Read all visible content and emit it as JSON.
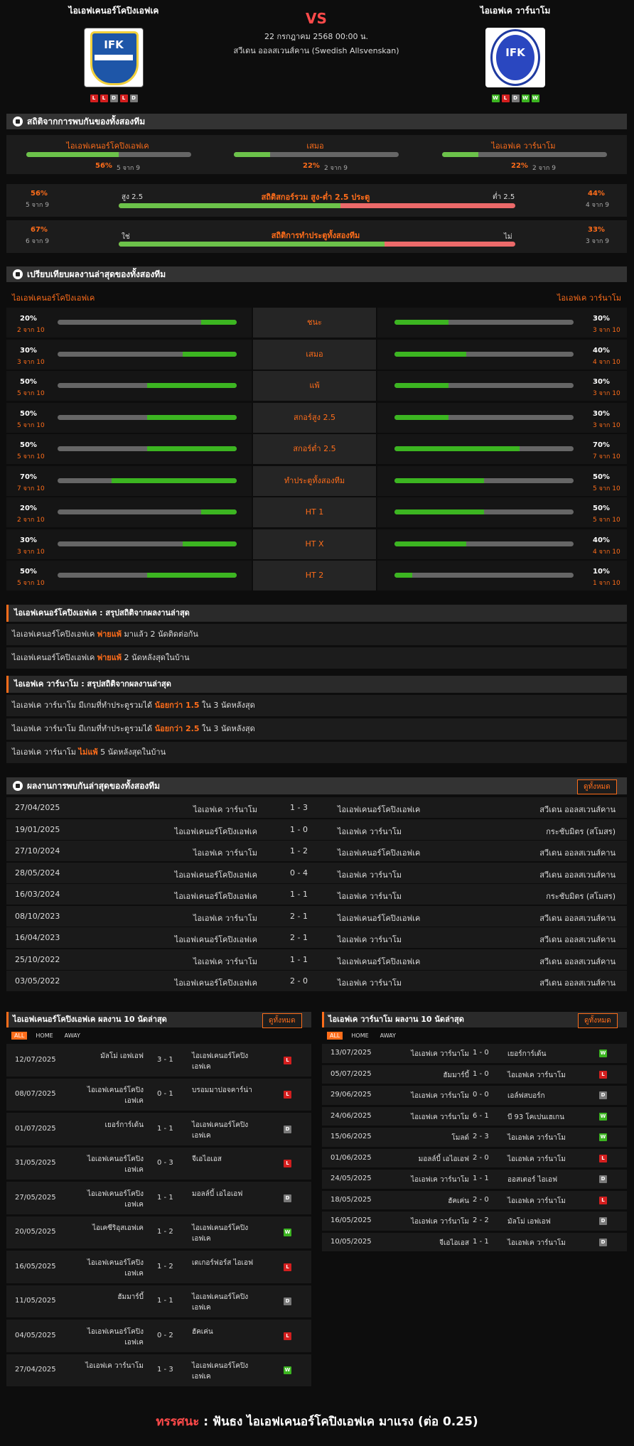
{
  "match": {
    "home": "ไอเอฟเคนอร์โคปิงเอฟเค",
    "away": "ไอเอฟเค วาร์นาโม",
    "vs": "VS",
    "date": "22 กรกฎาคม 2568 00:00 น.",
    "league": "สวีเดน ออลสเวนส์คาน (Swedish Allsvenskan)",
    "home_logo_text": "IFK",
    "away_logo_text": "IFK",
    "home_form": [
      "L",
      "L",
      "D",
      "L",
      "D"
    ],
    "away_form": [
      "W",
      "L",
      "D",
      "W",
      "W"
    ]
  },
  "h2h_stats": {
    "title": "สถิติจากการพบกันของทั้งสองทีม",
    "cols": [
      {
        "label": "ไอเอฟเคนอร์โคปิงเอฟเค",
        "pct": "56%",
        "sub": "5 จาก 9",
        "value": 0.56
      },
      {
        "label": "เสมอ",
        "pct": "22%",
        "sub": "2 จาก 9",
        "value": 0.22
      },
      {
        "label": "ไอเอฟเค วาร์นาโม",
        "pct": "22%",
        "sub": "2 จาก 9",
        "value": 0.22
      }
    ],
    "ou": {
      "title": "สถิติสกอร์รวม สูง-ต่ำ 2.5 ประตู",
      "left_label": "สูง 2.5",
      "right_label": "ต่ำ 2.5",
      "left_pct": "56%",
      "left_sub": "5 จาก 9",
      "right_pct": "44%",
      "right_sub": "4 จาก 9",
      "value": 0.56
    },
    "btts": {
      "title": "สถิติการทำประตูทั้งสองทีม",
      "left_label": "ใช่",
      "right_label": "ไม่",
      "left_pct": "67%",
      "left_sub": "6 จาก 9",
      "right_pct": "33%",
      "right_sub": "3 จาก 9",
      "value": 0.67
    }
  },
  "compare": {
    "title": "เปรียบเทียบผลงานล่าสุดของทั้งสองทีม",
    "home_label": "ไอเอฟเคนอร์โคปิงเอฟเค",
    "away_label": "ไอเอฟเค วาร์นาโม",
    "rows": [
      {
        "label": "ชนะ",
        "l_pct": "20%",
        "l_sub": "2 จาก 10",
        "l": 0.2,
        "r_pct": "30%",
        "r_sub": "3 จาก 10",
        "r": 0.3
      },
      {
        "label": "เสมอ",
        "l_pct": "30%",
        "l_sub": "3 จาก 10",
        "l": 0.3,
        "r_pct": "40%",
        "r_sub": "4 จาก 10",
        "r": 0.4
      },
      {
        "label": "แพ้",
        "l_pct": "50%",
        "l_sub": "5 จาก 10",
        "l": 0.5,
        "r_pct": "30%",
        "r_sub": "3 จาก 10",
        "r": 0.3
      },
      {
        "label": "สกอร์สูง 2.5",
        "l_pct": "50%",
        "l_sub": "5 จาก 10",
        "l": 0.5,
        "r_pct": "30%",
        "r_sub": "3 จาก 10",
        "r": 0.3
      },
      {
        "label": "สกอร์ต่ำ 2.5",
        "l_pct": "50%",
        "l_sub": "5 จาก 10",
        "l": 0.5,
        "r_pct": "70%",
        "r_sub": "7 จาก 10",
        "r": 0.7
      },
      {
        "label": "ทำประตูทั้งสองทีม",
        "l_pct": "70%",
        "l_sub": "7 จาก 10",
        "l": 0.7,
        "r_pct": "50%",
        "r_sub": "5 จาก 10",
        "r": 0.5
      },
      {
        "label": "HT 1",
        "l_pct": "20%",
        "l_sub": "2 จาก 10",
        "l": 0.2,
        "r_pct": "50%",
        "r_sub": "5 จาก 10",
        "r": 0.5
      },
      {
        "label": "HT X",
        "l_pct": "30%",
        "l_sub": "3 จาก 10",
        "l": 0.3,
        "r_pct": "40%",
        "r_sub": "4 จาก 10",
        "r": 0.4
      },
      {
        "label": "HT 2",
        "l_pct": "50%",
        "l_sub": "5 จาก 10",
        "l": 0.5,
        "r_pct": "10%",
        "r_sub": "1 จาก 10",
        "r": 0.1
      }
    ]
  },
  "home_summary": {
    "title": "ไอเอฟเคนอร์โคปิงเอฟเค : สรุปสถิติจากผลงานล่าสุด",
    "rows": [
      [
        "ไอเอฟเคนอร์โคปิงเอฟเค ",
        "พ่ายแพ้",
        " มาแล้ว 2 นัดติดต่อกัน"
      ],
      [
        "ไอเอฟเคนอร์โคปิงเอฟเค ",
        "พ่ายแพ้",
        " 2 นัดหลังสุดในบ้าน"
      ]
    ]
  },
  "away_summary": {
    "title": "ไอเอฟเค วาร์นาโม : สรุปสถิติจากผลงานล่าสุด",
    "rows": [
      [
        "ไอเอฟเค วาร์นาโม มีเกมที่ทำประตูรวมได้ ",
        "น้อยกว่า 1.5",
        " ใน 3 นัดหลังสุด"
      ],
      [
        "ไอเอฟเค วาร์นาโม มีเกมที่ทำประตูรวมได้ ",
        "น้อยกว่า 2.5",
        " ใน 3 นัดหลังสุด"
      ],
      [
        "ไอเอฟเค วาร์นาโม ",
        "ไม่แพ้",
        " 5 นัดหลังสุดในบ้าน"
      ]
    ]
  },
  "h2h_results": {
    "title": "ผลงานการพบกันล่าสุดของทั้งสองทีม",
    "see_all": "ดูทั้งหมด",
    "rows": [
      [
        "27/04/2025",
        "ไอเอฟเค วาร์นาโม",
        "1 - 3",
        "ไอเอฟเคนอร์โคปิงเอฟเค",
        "สวีเดน ออลสเวนส์คาน"
      ],
      [
        "19/01/2025",
        "ไอเอฟเคนอร์โคปิงเอฟเค",
        "1 - 0",
        "ไอเอฟเค วาร์นาโม",
        "กระชับมิตร (สโมสร)"
      ],
      [
        "27/10/2024",
        "ไอเอฟเค วาร์นาโม",
        "1 - 2",
        "ไอเอฟเคนอร์โคปิงเอฟเค",
        "สวีเดน ออลสเวนส์คาน"
      ],
      [
        "28/05/2024",
        "ไอเอฟเคนอร์โคปิงเอฟเค",
        "0 - 4",
        "ไอเอฟเค วาร์นาโม",
        "สวีเดน ออลสเวนส์คาน"
      ],
      [
        "16/03/2024",
        "ไอเอฟเคนอร์โคปิงเอฟเค",
        "1 - 1",
        "ไอเอฟเค วาร์นาโม",
        "กระชับมิตร (สโมสร)"
      ],
      [
        "08/10/2023",
        "ไอเอฟเค วาร์นาโม",
        "2 - 1",
        "ไอเอฟเคนอร์โคปิงเอฟเค",
        "สวีเดน ออลสเวนส์คาน"
      ],
      [
        "16/04/2023",
        "ไอเอฟเคนอร์โคปิงเอฟเค",
        "2 - 1",
        "ไอเอฟเค วาร์นาโม",
        "สวีเดน ออลสเวนส์คาน"
      ],
      [
        "25/10/2022",
        "ไอเอฟเค วาร์นาโม",
        "1 - 1",
        "ไอเอฟเคนอร์โคปิงเอฟเค",
        "สวีเดน ออลสเวนส์คาน"
      ],
      [
        "03/05/2022",
        "ไอเอฟเคนอร์โคปิงเอฟเค",
        "2 - 0",
        "ไอเอฟเค วาร์นาโม",
        "สวีเดน ออลสเวนส์คาน"
      ]
    ]
  },
  "home_last10": {
    "title": "ไอเอฟเคนอร์โคปิงเอฟเค ผลงาน 10 นัดล่าสุด",
    "see_all": "ดูทั้งหมด",
    "tabs": [
      "ALL",
      "HOME",
      "AWAY"
    ],
    "rows": [
      [
        "12/07/2025",
        "มัลโม่ เอฟเอฟ",
        "3 - 1",
        "ไอเอฟเคนอร์โคปิงเอฟเค",
        "L"
      ],
      [
        "08/07/2025",
        "ไอเอฟเคนอร์โคปิงเอฟเค",
        "0 - 1",
        "บรอมมาปอจคาร์น่า",
        "L"
      ],
      [
        "01/07/2025",
        "เยอร์การ์เด้น",
        "1 - 1",
        "ไอเอฟเคนอร์โคปิงเอฟเค",
        "D"
      ],
      [
        "31/05/2025",
        "ไอเอฟเคนอร์โคปิงเอฟเค",
        "0 - 3",
        "จีเอไอเอส",
        "L"
      ],
      [
        "27/05/2025",
        "ไอเอฟเคนอร์โคปิงเอฟเค",
        "1 - 1",
        "มอลล์บี้ เอไอเอฟ",
        "D"
      ],
      [
        "20/05/2025",
        "ไอเคซีริอุสเอฟเค",
        "1 - 2",
        "ไอเอฟเคนอร์โคปิงเอฟเค",
        "W"
      ],
      [
        "16/05/2025",
        "ไอเอฟเคนอร์โคปิงเอฟเค",
        "1 - 2",
        "เดเกอร์ฟอร์ส ไอเอฟ",
        "L"
      ],
      [
        "11/05/2025",
        "ฮัมมาร์บี้",
        "1 - 1",
        "ไอเอฟเคนอร์โคปิงเอฟเค",
        "D"
      ],
      [
        "04/05/2025",
        "ไอเอฟเคนอร์โคปิงเอฟเค",
        "0 - 2",
        "ฮัคเค่น",
        "L"
      ],
      [
        "27/04/2025",
        "ไอเอฟเค วาร์นาโม",
        "1 - 3",
        "ไอเอฟเคนอร์โคปิงเอฟเค",
        "W"
      ]
    ]
  },
  "away_last10": {
    "title": "ไอเอฟเค วาร์นาโม ผลงาน 10 นัดล่าสุด",
    "see_all": "ดูทั้งหมด",
    "tabs": [
      "ALL",
      "HOME",
      "AWAY"
    ],
    "rows": [
      [
        "13/07/2025",
        "ไอเอฟเค วาร์นาโม",
        "1 - 0",
        "เยอร์การ์เด้น",
        "W"
      ],
      [
        "05/07/2025",
        "ฮัมมาร์บี้",
        "1 - 0",
        "ไอเอฟเค วาร์นาโม",
        "L"
      ],
      [
        "29/06/2025",
        "ไอเอฟเค วาร์นาโม",
        "0 - 0",
        "เอล์ฟสบอร์ก",
        "D"
      ],
      [
        "24/06/2025",
        "ไอเอฟเค วาร์นาโม",
        "6 - 1",
        "บี 93 โคเปนเฮเกน",
        "W"
      ],
      [
        "15/06/2025",
        "โมลด์",
        "2 - 3",
        "ไอเอฟเค วาร์นาโม",
        "W"
      ],
      [
        "01/06/2025",
        "มอลล์บี้ เอไอเอฟ",
        "2 - 0",
        "ไอเอฟเค วาร์นาโม",
        "L"
      ],
      [
        "24/05/2025",
        "ไอเอฟเค วาร์นาโม",
        "1 - 1",
        "ออสเตอร์ ไอเอฟ",
        "D"
      ],
      [
        "18/05/2025",
        "ฮัคเค่น",
        "2 - 0",
        "ไอเอฟเค วาร์นาโม",
        "L"
      ],
      [
        "16/05/2025",
        "ไอเอฟเค วาร์นาโม",
        "2 - 2",
        "มัลโม่ เอฟเอฟ",
        "D"
      ],
      [
        "10/05/2025",
        "จีเอไอเอส",
        "1 - 1",
        "ไอเอฟเค วาร์นาโม",
        "D"
      ]
    ]
  },
  "verdict": {
    "label": "ทรรศนะ",
    "sep": " : ",
    "text": "ฟันธง ไอเอฟเคนอร์โคปิงเอฟเค มาแรง (ต่อ 0.25)"
  }
}
